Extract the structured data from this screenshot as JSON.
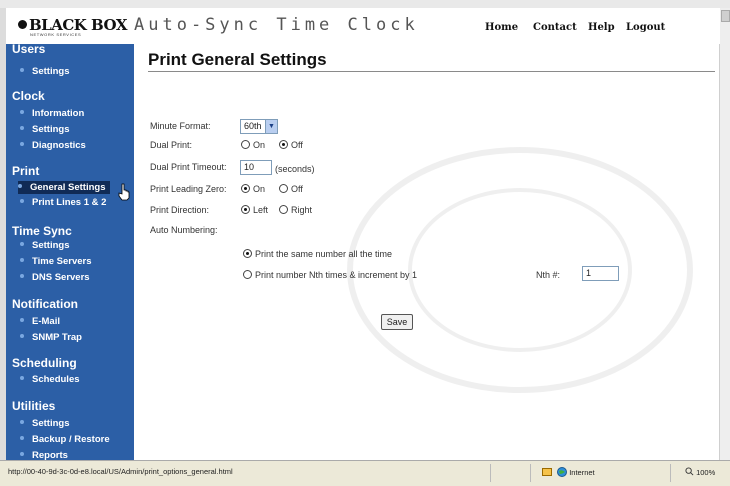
{
  "header": {
    "logo_text": "BLACK BOX",
    "logo_subtext": "NETWORK SERVICES",
    "app_title": "Auto-Sync Time Clock",
    "nav": [
      "Home",
      "Contact",
      "Help",
      "Logout"
    ]
  },
  "sidebar": {
    "sections": [
      {
        "title": "Users",
        "items": [
          "Settings"
        ]
      },
      {
        "title": "Clock",
        "items": [
          "Information",
          "Settings",
          "Diagnostics"
        ]
      },
      {
        "title": "Print",
        "items": [
          "General Settings",
          "Print Lines 1 & 2"
        ]
      },
      {
        "title": "Time Sync",
        "items": [
          "Settings",
          "Time Servers",
          "DNS Servers"
        ]
      },
      {
        "title": "Notification",
        "items": [
          "E-Mail",
          "SNMP Trap"
        ]
      },
      {
        "title": "Scheduling",
        "items": [
          "Schedules"
        ]
      },
      {
        "title": "Utilities",
        "items": [
          "Settings",
          "Backup / Restore",
          "Reports"
        ]
      }
    ],
    "active_item": "General Settings"
  },
  "main": {
    "title": "Print General Settings",
    "minute_format": {
      "label": "Minute Format:",
      "value": "60th"
    },
    "dual_print": {
      "label": "Dual Print:",
      "on": "On",
      "off": "Off",
      "selected": "Off"
    },
    "dual_print_timeout": {
      "label": "Dual Print Timeout:",
      "value": "10",
      "unit": "(seconds)"
    },
    "print_leading_zero": {
      "label": "Print Leading Zero:",
      "on": "On",
      "off": "Off",
      "selected": "On"
    },
    "print_direction": {
      "label": "Print Direction:",
      "left": "Left",
      "right": "Right",
      "selected": "Left"
    },
    "auto_numbering": {
      "label": "Auto Numbering:",
      "option_same": "Print the same number all the time",
      "option_nth": "Print number Nth times & increment by 1",
      "selected": "same",
      "nth_label": "Nth #:",
      "nth_value": "1"
    },
    "save_label": "Save"
  },
  "statusbar": {
    "url": "http://00-40-9d-3c-0d-e8.local/US/Admin/print_options_general.html",
    "zone": "Internet",
    "zoom": "100%"
  },
  "colors": {
    "sidebar": "#2c5fa6",
    "active_item": "#102b56",
    "select_arrow": "#b9cef0"
  }
}
